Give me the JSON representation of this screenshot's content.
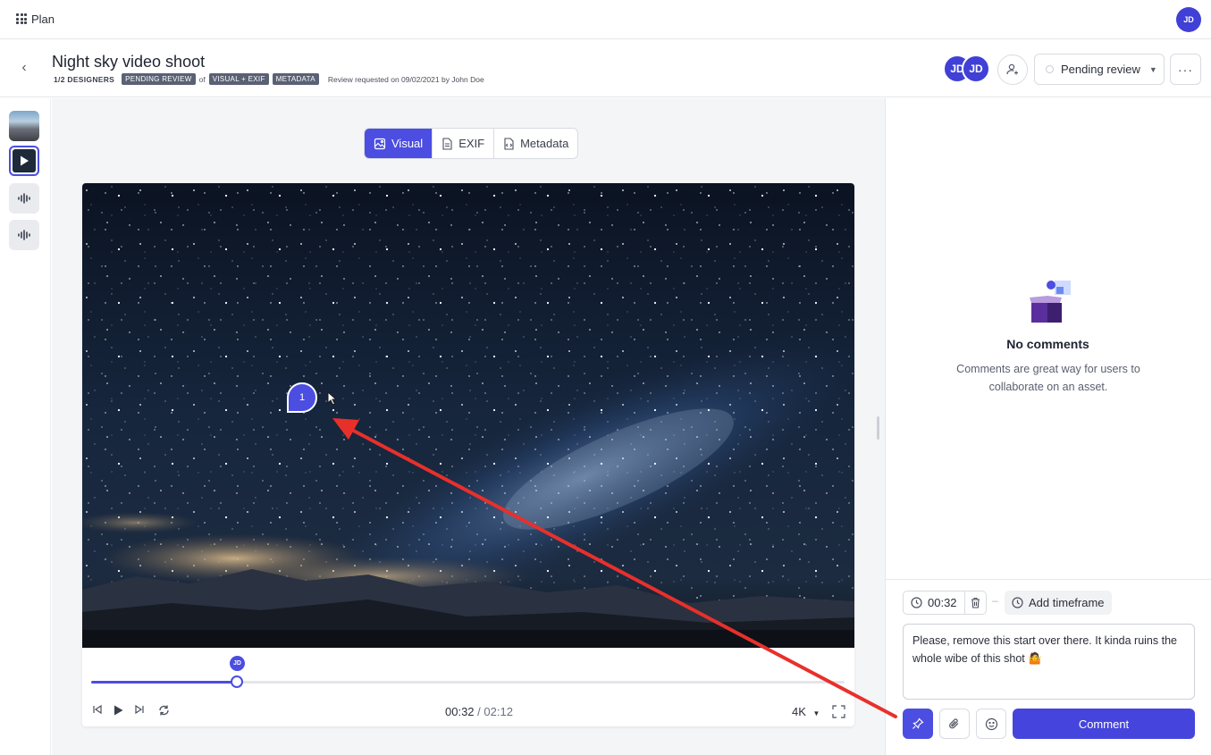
{
  "app": {
    "name": "Plan",
    "user_initials": "JD"
  },
  "header": {
    "title": "Night sky video shoot",
    "designers": "1/2 DESIGNERS",
    "status_tag": "PENDING REVIEW",
    "of_label": "of",
    "scope_tags": [
      "VISUAL + EXIF",
      "METADATA"
    ],
    "requested": "Review requested on 09/02/2021 by John Doe",
    "reviewers": [
      "JD",
      "JD"
    ],
    "status_select": "Pending review",
    "more_label": "···"
  },
  "view_tabs": [
    {
      "label": "Visual",
      "icon": "image-icon",
      "active": true
    },
    {
      "label": "EXIF",
      "icon": "document-icon",
      "active": false
    },
    {
      "label": "Metadata",
      "icon": "code-file-icon",
      "active": false
    }
  ],
  "player": {
    "current_time": "00:32",
    "separator": "/",
    "total_time": "02:12",
    "quality": "4K",
    "progress_fraction": 0.193,
    "marker_initials": "JD",
    "pin_number": "1"
  },
  "comments": {
    "empty_title": "No comments",
    "empty_desc": "Comments are great way for users to collaborate on an asset.",
    "timecode": "00:32",
    "timeframe_separator": "–",
    "add_timeframe": "Add timeframe",
    "draft": "Please, remove this start over there. It kinda ruins the whole wibe of this shot 🤷",
    "submit_label": "Comment"
  },
  "colors": {
    "accent": "#4b4ee0",
    "annotation_arrow": "#e8302b"
  }
}
